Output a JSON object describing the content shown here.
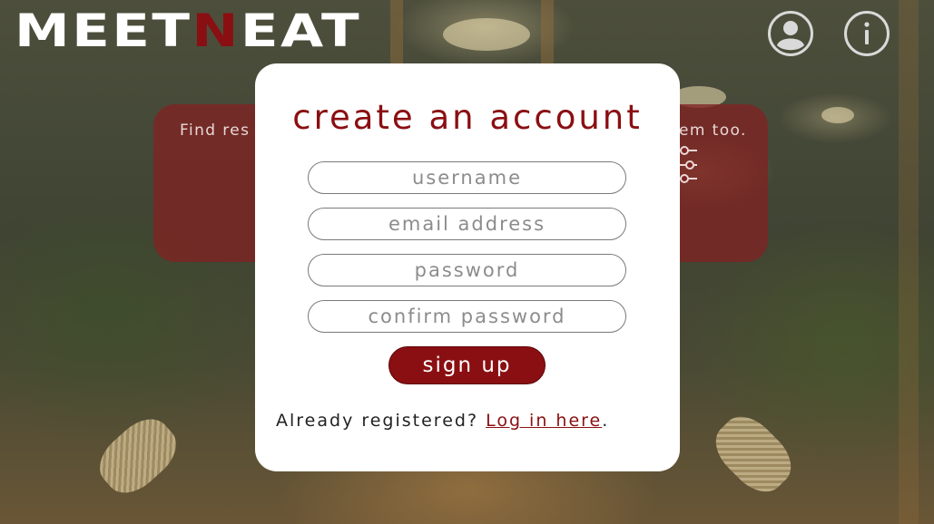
{
  "header": {
    "logo_part1": "MEET",
    "logo_part2": "N",
    "logo_part3": "EAT"
  },
  "icons": {
    "profile": "user-circle-icon",
    "info": "info-icon",
    "filter": "sliders-icon"
  },
  "banner": {
    "text_left": "Find res",
    "text_right": "em too."
  },
  "signup_card": {
    "title": "create an account",
    "fields": {
      "username": {
        "placeholder": "username",
        "value": ""
      },
      "email": {
        "placeholder": "email address",
        "value": ""
      },
      "password": {
        "placeholder": "password",
        "value": ""
      },
      "confirm": {
        "placeholder": "confirm password",
        "value": ""
      }
    },
    "signup_label": "sign up",
    "login_prompt": "Already registered? ",
    "login_link": "Log in here",
    "login_suffix": "."
  },
  "colors": {
    "brand_red": "#8a0f12",
    "banner_red": "#802222",
    "card_bg": "#ffffff",
    "icon_gray": "#d9d9d9"
  }
}
